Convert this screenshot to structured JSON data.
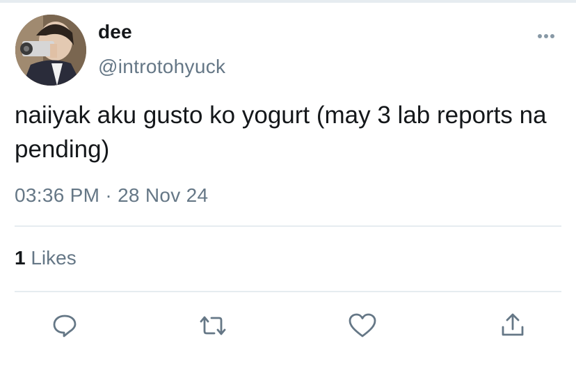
{
  "user": {
    "display_name": "dee",
    "handle": "@introtohyuck"
  },
  "tweet": {
    "text": "naiiyak aku gusto ko yogurt (may 3 lab reports na pending)",
    "time": "03:36 PM",
    "separator": "·",
    "date": "28 Nov 24"
  },
  "stats": {
    "likes_count": "1",
    "likes_label": "Likes"
  },
  "icons": {
    "more": "more-horizontal-icon",
    "reply": "reply-icon",
    "retweet": "retweet-icon",
    "like": "heart-icon",
    "share": "share-icon"
  },
  "colors": {
    "text_primary": "#14171a",
    "text_secondary": "#657786",
    "divider": "#e6ecf0"
  }
}
